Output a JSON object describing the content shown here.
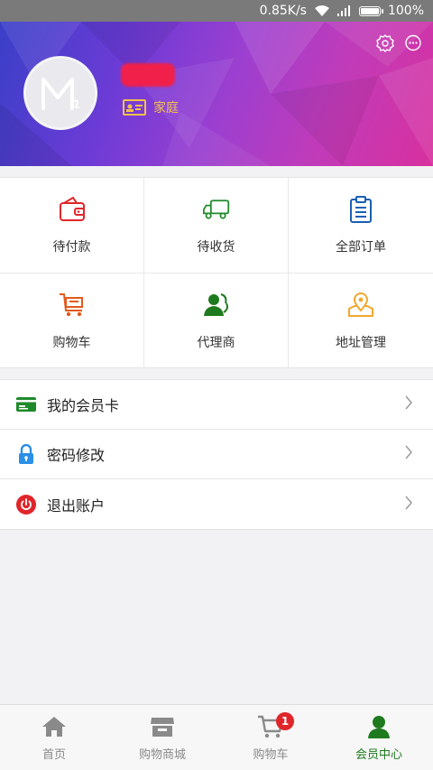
{
  "status_bar": {
    "speed": "0.85K/s",
    "battery": "100%"
  },
  "profile": {
    "member_type": "家庭"
  },
  "grid": [
    {
      "label": "待付款",
      "icon": "wallet-icon",
      "color": "#e0262b"
    },
    {
      "label": "待收货",
      "icon": "truck-icon",
      "color": "#1f8a2b"
    },
    {
      "label": "全部订单",
      "icon": "clipboard-icon",
      "color": "#1a5fb4"
    },
    {
      "label": "购物车",
      "icon": "cart-icon",
      "color": "#e25a1c"
    },
    {
      "label": "代理商",
      "icon": "agent-icon",
      "color": "#1e7a1e"
    },
    {
      "label": "地址管理",
      "icon": "map-pin-icon",
      "color": "#f0a830"
    }
  ],
  "menu": [
    {
      "label": "我的会员卡",
      "icon": "member-card-icon",
      "color": "#1f8a2b"
    },
    {
      "label": "密码修改",
      "icon": "lock-icon",
      "color": "#2b8fe8"
    },
    {
      "label": "退出账户",
      "icon": "power-icon",
      "color": "#e0262b"
    }
  ],
  "tabbar": {
    "tabs": [
      {
        "label": "首页",
        "icon": "home-icon"
      },
      {
        "label": "购物商城",
        "icon": "store-icon"
      },
      {
        "label": "购物车",
        "icon": "cart-icon"
      },
      {
        "label": "会员中心",
        "icon": "member-icon"
      }
    ],
    "cart_badge": "1",
    "active_color": "#1e7a1e",
    "inactive_color": "#8a8a8a"
  }
}
